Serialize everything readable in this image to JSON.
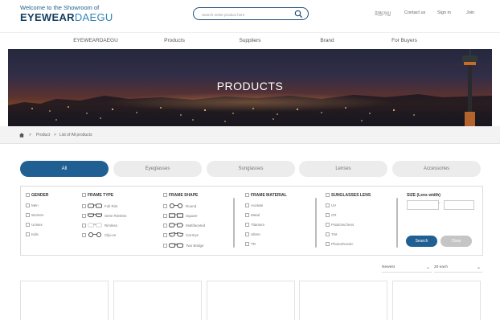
{
  "header": {
    "logo_sub": "Welcome to the Showroom of",
    "logo_bold": "EYEWEAR",
    "logo_light": "DAEGU",
    "search_placeholder": "Search entire product here",
    "util_links": [
      "회원가입",
      "Contact us",
      "Sign in",
      "Join"
    ]
  },
  "nav": {
    "items": [
      "EYEWEARDAEGU",
      "Products",
      "Suppliers",
      "Brand",
      "For Buyers"
    ]
  },
  "hero": {
    "title": "PRODUCTS"
  },
  "breadcrumb": {
    "items": [
      "Product",
      "List of All products"
    ]
  },
  "tabs": {
    "items": [
      "All",
      "Eyeglasses",
      "Sunglasses",
      "Lenses",
      "Accessories"
    ],
    "active": "All"
  },
  "filters": {
    "gender": {
      "title": "GENDER",
      "options": [
        "Men",
        "Women",
        "Unisex",
        "Kids"
      ]
    },
    "frame_type": {
      "title": "FRAME TYPE",
      "options": [
        "Full Rim",
        "Semi Rimless",
        "Rimless",
        "Clip-on"
      ]
    },
    "frame_shape": {
      "title": "FRAME SHAPE",
      "options": [
        "Round",
        "Square",
        "Multifaceted",
        "Cat Eye",
        "Two Bridge"
      ]
    },
    "frame_material": {
      "title": "FRAME MATERIAL",
      "options": [
        "Acetate",
        "Metal",
        "Titanium",
        "Ultem",
        "TR"
      ]
    },
    "sunglasses_lens": {
      "title": "SUNGLASSES LENS",
      "options": [
        "UV",
        "CR",
        "Polarized lens",
        "Tint",
        "Photochromic"
      ]
    },
    "size": {
      "title": "SIZE (Lens width)"
    },
    "search_label": "Search",
    "clear_label": "Clear"
  },
  "sort": {
    "order": "Newest",
    "per_page": "20 each"
  },
  "colors": {
    "accent": "#1f5f92",
    "logo_dark": "#173f63",
    "logo_light": "#2f86b8"
  }
}
